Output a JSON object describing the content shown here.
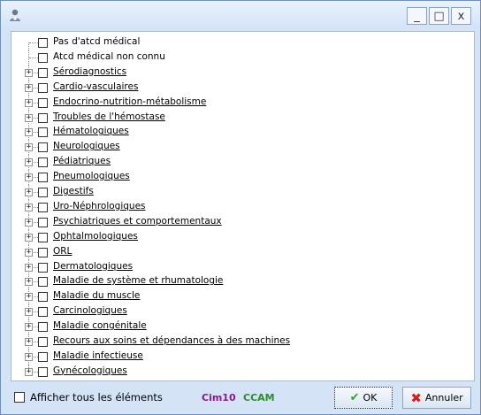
{
  "window": {
    "title": "",
    "controls": {
      "minimize": "_",
      "maximize": "□",
      "close": "x"
    }
  },
  "tree": {
    "items": [
      {
        "label": "Pas d'atcd médical",
        "expandable": false,
        "link": false
      },
      {
        "label": "Atcd médical non connu",
        "expandable": false,
        "link": false
      },
      {
        "label": "Sérodiagnostics",
        "expandable": true,
        "link": true
      },
      {
        "label": "Cardio-vasculaires",
        "expandable": true,
        "link": true
      },
      {
        "label": "Endocrino-nutrition-métabolisme",
        "expandable": true,
        "link": true
      },
      {
        "label": "Troubles de l'hémostase",
        "expandable": true,
        "link": true
      },
      {
        "label": "Hématologiques",
        "expandable": true,
        "link": true
      },
      {
        "label": "Neurologiques",
        "expandable": true,
        "link": true
      },
      {
        "label": "Pédiatriques",
        "expandable": true,
        "link": true
      },
      {
        "label": "Pneumologiques",
        "expandable": true,
        "link": true
      },
      {
        "label": "Digestifs",
        "expandable": true,
        "link": true
      },
      {
        "label": "Uro-Néphrologiques",
        "expandable": true,
        "link": true
      },
      {
        "label": "Psychiatriques et comportementaux",
        "expandable": true,
        "link": true
      },
      {
        "label": "Ophtalmologiques",
        "expandable": true,
        "link": true
      },
      {
        "label": "ORL",
        "expandable": true,
        "link": true
      },
      {
        "label": "Dermatologiques",
        "expandable": true,
        "link": true
      },
      {
        "label": "Maladie de système et rhumatologie",
        "expandable": true,
        "link": true
      },
      {
        "label": "Maladie du muscle",
        "expandable": true,
        "link": true
      },
      {
        "label": "Carcinologiques",
        "expandable": true,
        "link": true
      },
      {
        "label": "Maladie congénitale",
        "expandable": true,
        "link": true
      },
      {
        "label": "Recours aux soins et dépendances à des machines",
        "expandable": true,
        "link": true
      },
      {
        "label": "Maladie infectieuse",
        "expandable": true,
        "link": true
      },
      {
        "label": "Gynécologiques",
        "expandable": true,
        "link": true
      }
    ]
  },
  "footer": {
    "show_all_label": "Afficher tous les éléments",
    "cim10_label": "Cim10",
    "ccam_label": "CCAM",
    "ok_label": "OK",
    "cancel_label": "Annuler"
  },
  "colors": {
    "cim10": "#8b1a8b",
    "ccam": "#2e8b2e",
    "ok_icon": "#2fa32f",
    "cancel_icon": "#d62020"
  },
  "icons": {
    "app": "user-medical-icon",
    "ok": "checkmark-icon",
    "cancel": "x-icon"
  }
}
